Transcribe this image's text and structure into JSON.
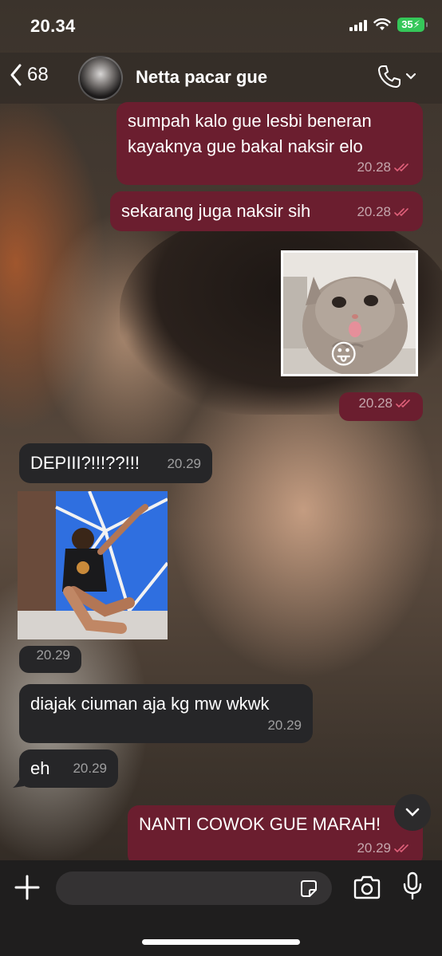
{
  "status_bar": {
    "time": "20.34",
    "battery": "35"
  },
  "header": {
    "back_count": "68",
    "contact_name": "Netta pacar gue"
  },
  "messages": [
    {
      "text": "sumpah kalo gue lesbi beneran kayaknya gue bakal naksir elo",
      "time": "20.28"
    },
    {
      "text": "sekarang juga naksir sih",
      "time": "20.28"
    },
    {
      "sticker_emoji": "😛",
      "time": "20.28"
    },
    {
      "text": "DEPIII?!!!??!!!",
      "time": "20.29"
    },
    {
      "time": "20.29"
    },
    {
      "text": "diajak ciuman aja kg mw wkwk",
      "time": "20.29"
    },
    {
      "text": "eh",
      "time": "20.29"
    },
    {
      "text": "NANTI COWOK GUE MARAH!",
      "time": "20.29"
    }
  ],
  "colors": {
    "outgoing": "#6b1e2f",
    "incoming": "#262628",
    "read_tick": "#e0607a",
    "battery": "#35c759"
  }
}
